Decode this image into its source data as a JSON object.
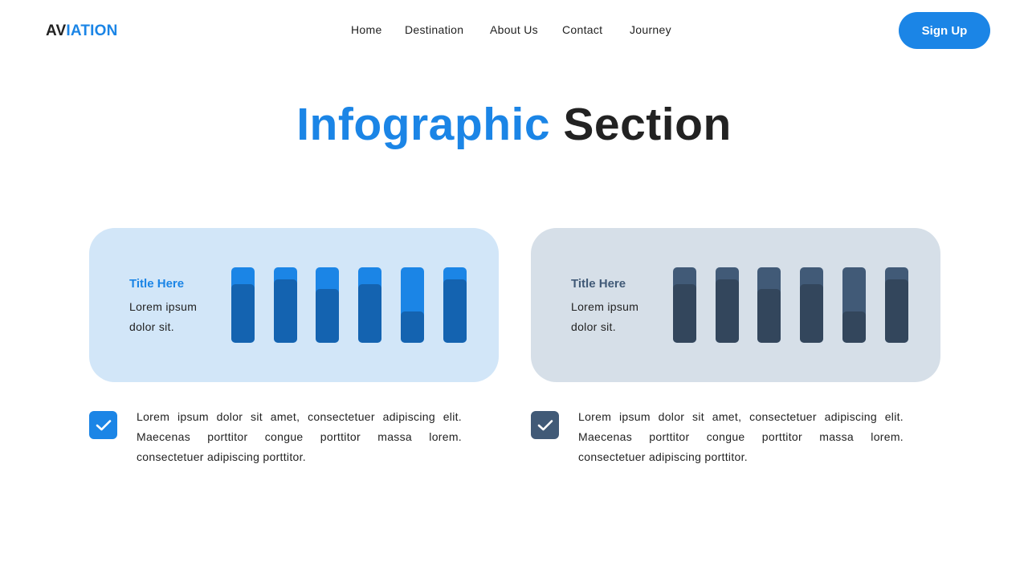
{
  "header": {
    "logo_part1": "AV",
    "logo_part2": "IATION",
    "nav": [
      {
        "label": "Home"
      },
      {
        "label": "Destination"
      },
      {
        "label": "About Us"
      },
      {
        "label": "Contact"
      },
      {
        "label": "Journey"
      }
    ],
    "signup_label": "Sign Up"
  },
  "section": {
    "title_part1": "Infographic",
    "title_part2": " Section"
  },
  "colors": {
    "accent": "#1b85e6",
    "dark_accent": "#415a77"
  },
  "cards": [
    {
      "title": "Title Here",
      "desc": "Lorem ipsum dolor sit.",
      "bg": "#d2e6f8",
      "title_color": "#1b85e6",
      "bar_bg": "#1b85e6",
      "bar_fill": "#1463b0",
      "levels": [
        0.78,
        0.84,
        0.71,
        0.78,
        0.41,
        0.84
      ],
      "text": "Lorem ipsum dolor sit amet, consectetuer adipiscing elit. Maecenas porttitor congue porttitor massa lorem. consectetuer adipiscing porttitor.",
      "check_color": "#1b85e6",
      "check_icon": "check-icon"
    },
    {
      "title": "Title Here",
      "desc": "Lorem ipsum dolor sit.",
      "bg": "#d6dfe8",
      "title_color": "#415a77",
      "bar_bg": "#415a77",
      "bar_fill": "#33465c",
      "levels": [
        0.78,
        0.84,
        0.71,
        0.78,
        0.41,
        0.84
      ],
      "text": "Lorem ipsum dolor sit amet, consectetuer adipiscing elit. Maecenas porttitor congue porttitor massa lorem. consectetuer adipiscing porttitor.",
      "check_color": "#415a77",
      "check_icon": "check-icon"
    }
  ]
}
